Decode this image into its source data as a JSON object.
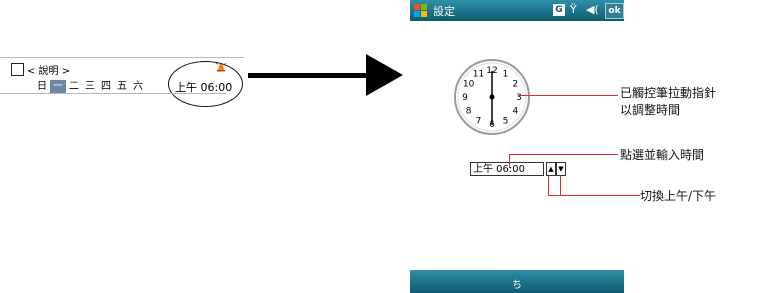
{
  "alarm_item": {
    "label": "< 說明 >",
    "days": [
      "日",
      "一",
      "二",
      "三",
      "四",
      "五",
      "六"
    ],
    "active_day_index": 1,
    "time": "上午 06:00"
  },
  "device": {
    "title": "設定",
    "status_icons": [
      "windows-logo-icon",
      "g-status-icon",
      "antenna-icon",
      "volume-icon"
    ],
    "ok_label": "ok",
    "clock_numbers": [
      "12",
      "1",
      "2",
      "3",
      "4",
      "5",
      "6",
      "7",
      "8",
      "9",
      "10",
      "11"
    ],
    "time_value": "上午 06:00",
    "spin_up": "▲",
    "spin_down": "▼",
    "sip_label": "ち"
  },
  "callouts": {
    "drag_hands": "已觸控筆拉動指針\n以調整時間",
    "tap_input": "點選並輸入時間",
    "toggle_ampm": "切換上午/下午"
  },
  "colors": {
    "titlebar": "#0d5b70",
    "callout_line": "#e12a2a",
    "day_highlight": "#6f87a7"
  }
}
